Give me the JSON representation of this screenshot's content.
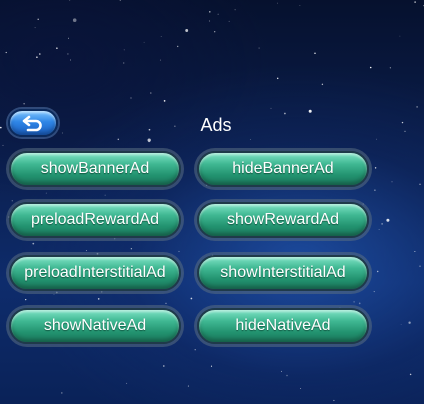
{
  "screen": {
    "title": "Ads"
  },
  "back_button": {
    "icon": "undo-arrow-icon"
  },
  "buttons": [
    {
      "label": "showBannerAd"
    },
    {
      "label": "hideBannerAd"
    },
    {
      "label": "preloadRewardAd"
    },
    {
      "label": "showRewardAd"
    },
    {
      "label": "preloadInterstitialAd"
    },
    {
      "label": "showInterstitialAd"
    },
    {
      "label": "showNativeAd"
    },
    {
      "label": "hideNativeAd"
    }
  ],
  "colors": {
    "button_green": "#3fb792",
    "back_blue": "#2f86e6",
    "background_navy": "#0a1d4a"
  }
}
